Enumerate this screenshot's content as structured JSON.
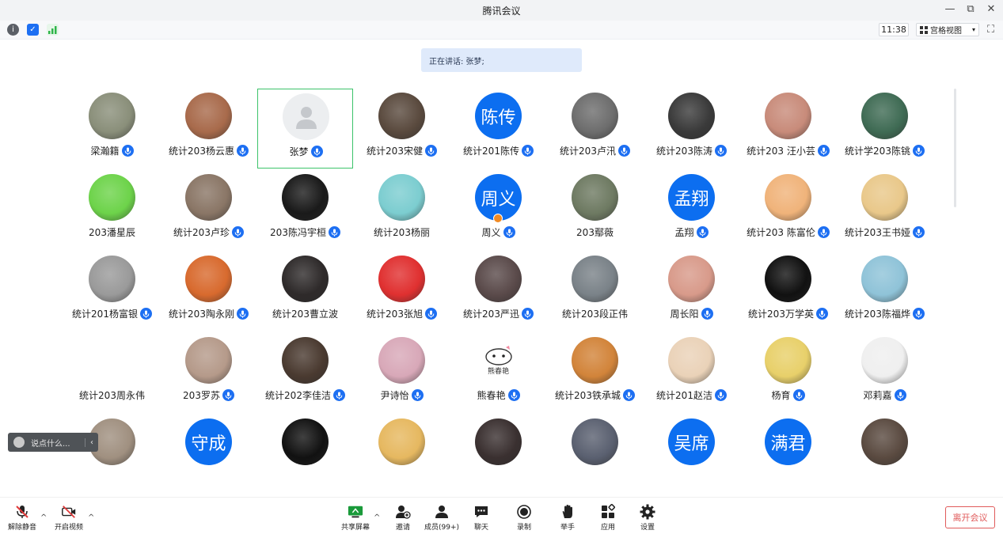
{
  "window": {
    "title": "腾讯会议",
    "minimize": "—",
    "restore": "⧉",
    "close": "✕"
  },
  "infobar": {
    "time": "11:38",
    "view_label": "宫格视图",
    "view_caret": "▾",
    "info_glyph": "i",
    "shield_glyph": "✓",
    "fullscreen_glyph": "⛶"
  },
  "speaking": {
    "text": "正在讲话: 张梦;"
  },
  "participants": [
    {
      "name": "梁瀚籍",
      "mic": true,
      "avatar_text": "",
      "style": "photo",
      "color": "#8a8f7a"
    },
    {
      "name": "统计203杨云惠",
      "mic": true,
      "avatar_text": "",
      "style": "photo",
      "color": "#a86a4b"
    },
    {
      "name": "张梦",
      "mic": true,
      "avatar_text": "",
      "style": "silhouette",
      "color": "#eceef0",
      "active": true
    },
    {
      "name": "统计203宋健",
      "mic": true,
      "avatar_text": "",
      "style": "photo",
      "color": "#5a4a3e"
    },
    {
      "name": "统计201陈传",
      "mic": true,
      "avatar_text": "陈传",
      "style": "text",
      "color": "#0c6ef0"
    },
    {
      "name": "统计203卢汛",
      "mic": true,
      "avatar_text": "",
      "style": "photo",
      "color": "#6d6d6d"
    },
    {
      "name": "统计203陈涛",
      "mic": true,
      "avatar_text": "",
      "style": "photo",
      "color": "#3a3a3a"
    },
    {
      "name": "统计203 汪小芸",
      "mic": true,
      "avatar_text": "",
      "style": "photo",
      "color": "#c88b7a"
    },
    {
      "name": "统计学203陈铫",
      "mic": true,
      "avatar_text": "",
      "style": "photo",
      "color": "#3f6b54"
    },
    {
      "name": "203潘星辰",
      "mic": false,
      "avatar_text": "",
      "style": "photo",
      "color": "#6dd34a"
    },
    {
      "name": "统计203卢珍",
      "mic": true,
      "avatar_text": "",
      "style": "photo",
      "color": "#8a7666"
    },
    {
      "name": "203陈冯宇桓",
      "mic": true,
      "avatar_text": "",
      "style": "photo",
      "color": "#1a1a1a"
    },
    {
      "name": "统计203杨丽",
      "mic": false,
      "avatar_text": "",
      "style": "photo",
      "color": "#7ccdd0"
    },
    {
      "name": "周义",
      "mic": true,
      "avatar_text": "周义",
      "style": "text",
      "color": "#0c6ef0",
      "host": true
    },
    {
      "name": "203鄢薇",
      "mic": false,
      "avatar_text": "",
      "style": "photo",
      "color": "#6e7a62"
    },
    {
      "name": "孟翔",
      "mic": true,
      "avatar_text": "孟翔",
      "style": "text",
      "color": "#0c6ef0"
    },
    {
      "name": "统计203 陈富伦",
      "mic": true,
      "avatar_text": "",
      "style": "photo",
      "color": "#f0b37a"
    },
    {
      "name": "统计203王书娅",
      "mic": true,
      "avatar_text": "",
      "style": "photo",
      "color": "#e9c88a"
    },
    {
      "name": "统计201杨富银",
      "mic": true,
      "avatar_text": "",
      "style": "photo",
      "color": "#9a9a9a"
    },
    {
      "name": "统计203陶永刚",
      "mic": true,
      "avatar_text": "",
      "style": "photo",
      "color": "#d86a2e"
    },
    {
      "name": "统计203曹立波",
      "mic": false,
      "avatar_text": "",
      "style": "photo",
      "color": "#2e2a2a"
    },
    {
      "name": "统计203张旭",
      "mic": true,
      "avatar_text": "",
      "style": "photo",
      "color": "#e03030"
    },
    {
      "name": "统计203严迅",
      "mic": true,
      "avatar_text": "",
      "style": "photo",
      "color": "#5a4a4a"
    },
    {
      "name": "统计203段正伟",
      "mic": false,
      "avatar_text": "",
      "style": "photo",
      "color": "#7a8288"
    },
    {
      "name": "周长阳",
      "mic": true,
      "avatar_text": "",
      "style": "photo",
      "color": "#d89a8a"
    },
    {
      "name": "统计203万学英",
      "mic": true,
      "avatar_text": "",
      "style": "photo",
      "color": "#111111"
    },
    {
      "name": "统计203陈福烨",
      "mic": true,
      "avatar_text": "",
      "style": "photo",
      "color": "#8fc3d8"
    },
    {
      "name": "统计203周永伟",
      "mic": false,
      "avatar_text": "",
      "style": "blank",
      "color": "#ffffff"
    },
    {
      "name": "203罗苏",
      "mic": true,
      "avatar_text": "",
      "style": "photo",
      "color": "#b59a8a"
    },
    {
      "name": "统计202李佳洁",
      "mic": true,
      "avatar_text": "",
      "style": "photo",
      "color": "#4a3a30"
    },
    {
      "name": "尹诗怡",
      "mic": true,
      "avatar_text": "",
      "style": "photo",
      "color": "#d8a8b8"
    },
    {
      "name": "熊春艳",
      "mic": true,
      "avatar_text": "熊春艳",
      "style": "sticker",
      "color": "#ffffff"
    },
    {
      "name": "统计203铁承城",
      "mic": true,
      "avatar_text": "",
      "style": "photo",
      "color": "#d2843a"
    },
    {
      "name": "统计201赵洁",
      "mic": true,
      "avatar_text": "",
      "style": "photo",
      "color": "#ead2b8"
    },
    {
      "name": "杨育",
      "mic": true,
      "avatar_text": "",
      "style": "photo",
      "color": "#e8d06a"
    },
    {
      "name": "邓莉嘉",
      "mic": true,
      "avatar_text": "",
      "style": "photo",
      "color": "#efefef"
    },
    {
      "name": "",
      "mic": false,
      "avatar_text": "",
      "style": "photo",
      "color": "#a09080"
    },
    {
      "name": "",
      "mic": false,
      "avatar_text": "守成",
      "style": "text",
      "color": "#0c6ef0"
    },
    {
      "name": "",
      "mic": false,
      "avatar_text": "",
      "style": "photo",
      "color": "#111111"
    },
    {
      "name": "",
      "mic": false,
      "avatar_text": "",
      "style": "photo",
      "color": "#e6b860"
    },
    {
      "name": "",
      "mic": false,
      "avatar_text": "",
      "style": "photo",
      "color": "#3a3030"
    },
    {
      "name": "",
      "mic": false,
      "avatar_text": "",
      "style": "photo",
      "color": "#5a6070"
    },
    {
      "name": "",
      "mic": false,
      "avatar_text": "吴席",
      "style": "text",
      "color": "#0c6ef0"
    },
    {
      "name": "",
      "mic": false,
      "avatar_text": "满君",
      "style": "text",
      "color": "#0c6ef0"
    },
    {
      "name": "",
      "mic": false,
      "avatar_text": "",
      "style": "photo",
      "color": "#5a4a40"
    }
  ],
  "chat": {
    "placeholder": "说点什么...",
    "arrow": "‹"
  },
  "toolbar": {
    "unmute": "解除静音",
    "start_video": "开启视频",
    "share_screen": "共享屏幕",
    "invite": "邀请",
    "members": "成员(99+)",
    "chat": "聊天",
    "record": "录制",
    "raise_hand": "举手",
    "apps": "应用",
    "settings": "设置",
    "leave": "离开会议",
    "caret": "^"
  },
  "colors": {
    "accent": "#1d6ff2",
    "active_border": "#3cc36a",
    "leave_red": "#e05a5a",
    "mute_red": "#e03a3a"
  }
}
